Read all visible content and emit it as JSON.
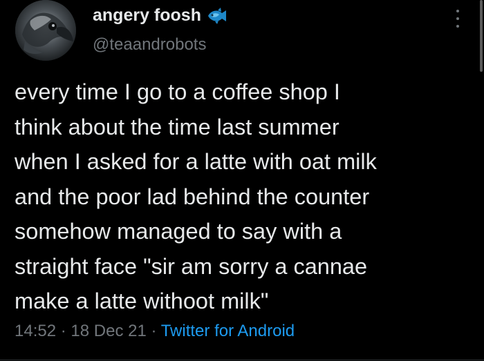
{
  "author": {
    "display_name": "angery foosh",
    "handle": "@teaandrobots",
    "avatar_icon": "betta-fish-avatar",
    "name_emoji_icon": "fish-emoji-icon"
  },
  "tweet": {
    "text": "every time I go to a coffee shop I\nthink about the time last summer\nwhen I asked for a latte with oat milk\nand the poor lad behind the counter\nsomehow managed to say with a\nstraight face \"sir am sorry a cannae\nmake a latte withoot milk\"",
    "time": "14:52",
    "separator": "·",
    "date": "18 Dec 21",
    "source": "Twitter for Android"
  },
  "menu": {
    "icon": "more-options-icon"
  },
  "colors": {
    "background": "#000000",
    "text": "#e7e9ea",
    "muted": "#71767b",
    "link": "#1d9bf0"
  }
}
